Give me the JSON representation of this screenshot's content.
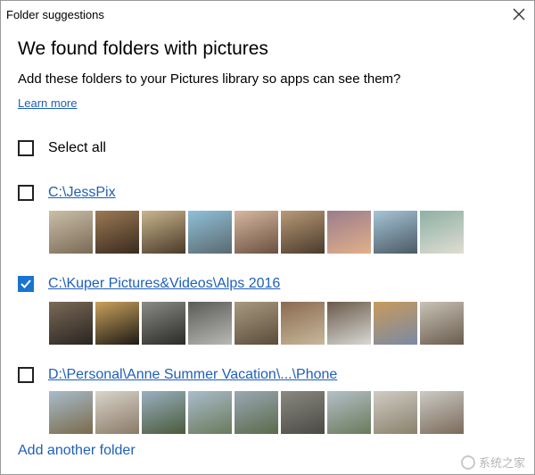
{
  "window": {
    "title": "Folder suggestions"
  },
  "dialog": {
    "heading": "We found folders with pictures",
    "subheading": "Add these folders to your Pictures library so apps can see them?",
    "learn_more": "Learn more",
    "select_all": {
      "label": "Select all",
      "checked": false
    },
    "add_folder": "Add another folder"
  },
  "folders": [
    {
      "path": "C:\\JessPix",
      "checked": false,
      "thumbs": [
        [
          "#cbbfa8",
          "#7a6a55"
        ],
        [
          "#9a7a55",
          "#3a2a1e"
        ],
        [
          "#c9b58e",
          "#4a3a28"
        ],
        [
          "#8fc0d8",
          "#5a6a70"
        ],
        [
          "#d6b8a0",
          "#6a5040"
        ],
        [
          "#b89a78",
          "#4a3a2a"
        ],
        [
          "#9a7d8c",
          "#e2b08a"
        ],
        [
          "#a6c4d6",
          "#4a5a64"
        ],
        [
          "#8eb0a4",
          "#e0ddd2"
        ]
      ]
    },
    {
      "path": "C:\\Kuper Pictures&Videos\\Alps 2016",
      "checked": true,
      "thumbs": [
        [
          "#7a6a58",
          "#2a2420"
        ],
        [
          "#caa25c",
          "#1e1a16"
        ],
        [
          "#8a8a86",
          "#2a2a28"
        ],
        [
          "#5a5a58",
          "#b8b8b4"
        ],
        [
          "#a89a80",
          "#5a4c3a"
        ],
        [
          "#8a6a4e",
          "#c8b89c"
        ],
        [
          "#6a5a4a",
          "#d8d8d4"
        ],
        [
          "#c89a5c",
          "#7a8aa4"
        ],
        [
          "#c8c2b6",
          "#6a5c4e"
        ]
      ]
    },
    {
      "path": "D:\\Personal\\Anne Summer Vacation\\...\\Phone",
      "checked": false,
      "thumbs": [
        [
          "#a8bccc",
          "#7a6a4a"
        ],
        [
          "#d8d4ca",
          "#8a7a68"
        ],
        [
          "#9ab0c0",
          "#4a5a3a"
        ],
        [
          "#aabccc",
          "#6a7a5a"
        ],
        [
          "#9aa8b4",
          "#5a6a4a"
        ],
        [
          "#8a8880",
          "#4a4a44"
        ],
        [
          "#b4c0c8",
          "#6a7a5a"
        ],
        [
          "#d0ccc4",
          "#8a806c"
        ],
        [
          "#cccac4",
          "#7a6a5a"
        ]
      ]
    }
  ],
  "watermark": {
    "text": "系统之家"
  },
  "colors": {
    "link": "#1f5fb8",
    "check_fill": "#1a73d0"
  }
}
